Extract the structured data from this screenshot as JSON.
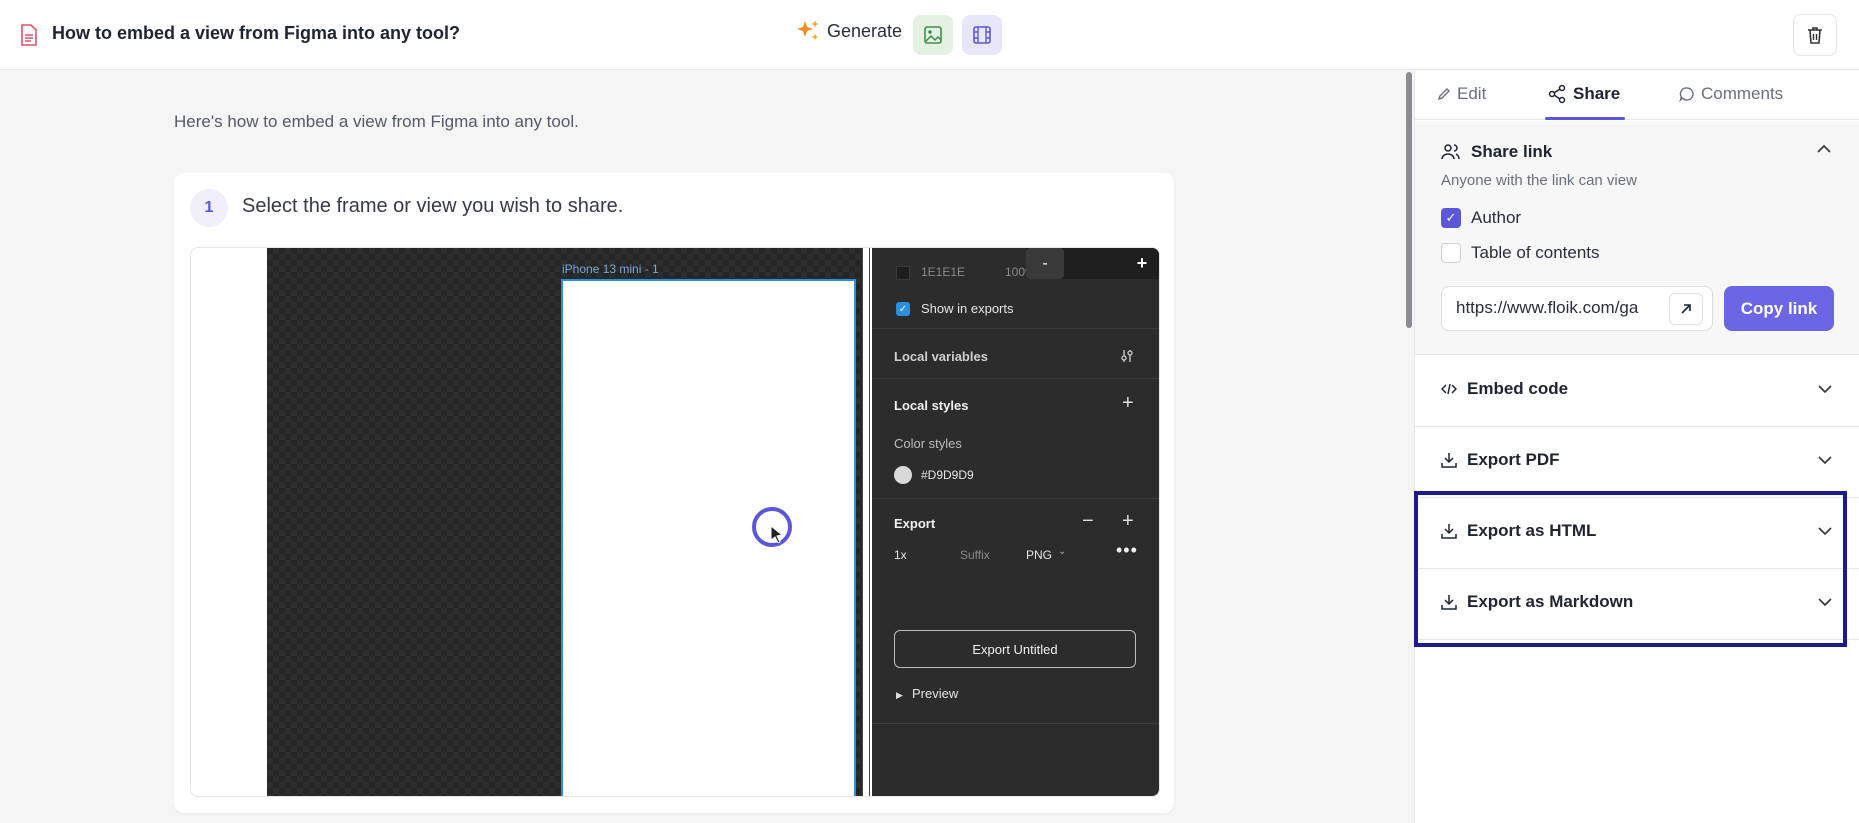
{
  "header": {
    "doc_title": "How to embed a view from Figma into any tool?",
    "generate_label": "Generate"
  },
  "main": {
    "intro": "Here's how to embed a view from Figma into any tool.",
    "step": {
      "number": "1",
      "text": "Select the frame or view you wish to share."
    },
    "figma": {
      "frame_label": "iPhone 13 mini - 1",
      "zoom_minus": "-",
      "zoom_plus": "+",
      "fill_hex": "1E1E1E",
      "fill_opacity": "100%",
      "show_in_exports": "Show in exports",
      "local_variables": "Local variables",
      "local_styles": "Local styles",
      "color_styles": "Color styles",
      "color_value": "#D9D9D9",
      "export_title": "Export",
      "export_scale": "1x",
      "export_suffix": "Suffix",
      "export_format": "PNG",
      "export_button": "Export Untitled",
      "preview": "Preview"
    }
  },
  "sidebar": {
    "tabs": [
      {
        "label": "Edit"
      },
      {
        "label": "Share"
      },
      {
        "label": "Comments"
      }
    ],
    "share_link": {
      "title": "Share link",
      "subtitle": "Anyone with the link can view",
      "options": [
        {
          "label": "Author",
          "checked": true
        },
        {
          "label": "Table of contents",
          "checked": false
        }
      ],
      "url": "https://www.floik.com/ga",
      "copy_label": "Copy link"
    },
    "sections": [
      {
        "label": "Embed code"
      },
      {
        "label": "Export PDF"
      },
      {
        "label": "Export as HTML"
      },
      {
        "label": "Export as Markdown"
      }
    ]
  },
  "colors": {
    "accent": "#5b57d6",
    "highlight_border": "#1f1a8a",
    "copy_button": "#6a66e4"
  }
}
